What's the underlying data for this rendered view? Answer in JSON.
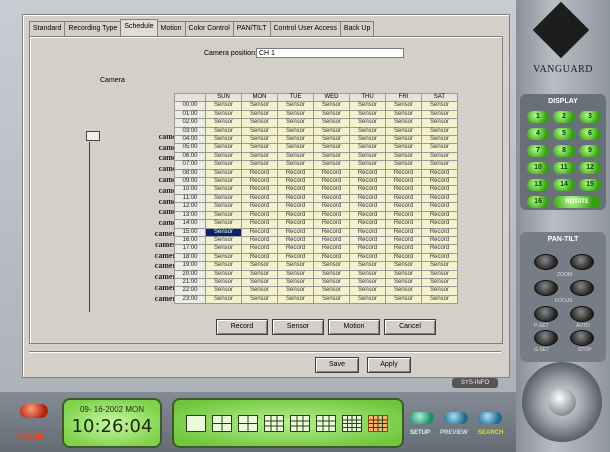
{
  "tabs": [
    "Standard",
    "Recording Type",
    "Schedule",
    "Motion",
    "Color Control",
    "PAN/TILT",
    "Control User Access",
    "Back Up"
  ],
  "active_tab": "Schedule",
  "camera_position_label": "Camera position:",
  "camera_position_value": "CH 1",
  "camera_heading": "Camera",
  "cameras": [
    "camera 1",
    "camera 2",
    "camera 3",
    "camera 4",
    "camera 5",
    "camera 6",
    "camera 7",
    "camera 8",
    "camera 9",
    "camera 10",
    "camera 11",
    "camera 12",
    "camera 13",
    "camera 14",
    "camera 15",
    "camera 16"
  ],
  "selected_camera": "camera 1",
  "days": [
    "SUN",
    "MON",
    "TUE",
    "WED",
    "THU",
    "FRI",
    "SAT"
  ],
  "hours": [
    "00:00",
    "01:00",
    "02:00",
    "03:00",
    "04:00",
    "05:00",
    "06:00",
    "07:00",
    "08:00",
    "09:00",
    "10:00",
    "11:00",
    "12:00",
    "13:00",
    "14:00",
    "15:00",
    "16:00",
    "17:00",
    "18:00",
    "19:00",
    "20:00",
    "21:00",
    "22:00",
    "23:00"
  ],
  "schedule": [
    [
      "Sensor",
      "Sensor",
      "Sensor",
      "Sensor",
      "Sensor",
      "Sensor",
      "Sensor"
    ],
    [
      "Sensor",
      "Sensor",
      "Sensor",
      "Sensor",
      "Sensor",
      "Sensor",
      "Sensor"
    ],
    [
      "Sensor",
      "Sensor",
      "Sensor",
      "Sensor",
      "Sensor",
      "Sensor",
      "Sensor"
    ],
    [
      "Sensor",
      "Sensor",
      "Sensor",
      "Sensor",
      "Sensor",
      "Sensor",
      "Sensor"
    ],
    [
      "Sensor",
      "Sensor",
      "Sensor",
      "Sensor",
      "Sensor",
      "Sensor",
      "Sensor"
    ],
    [
      "Sensor",
      "Sensor",
      "Sensor",
      "Sensor",
      "Sensor",
      "Sensor",
      "Sensor"
    ],
    [
      "Sensor",
      "Sensor",
      "Sensor",
      "Sensor",
      "Sensor",
      "Sensor",
      "Sensor"
    ],
    [
      "Sensor",
      "Sensor",
      "Sensor",
      "Sensor",
      "Sensor",
      "Sensor",
      "Sensor"
    ],
    [
      "Sensor",
      "Record",
      "Record",
      "Record",
      "Record",
      "Record",
      "Record"
    ],
    [
      "Sensor",
      "Record",
      "Record",
      "Record",
      "Record",
      "Record",
      "Record"
    ],
    [
      "Sensor",
      "Record",
      "Record",
      "Record",
      "Record",
      "Record",
      "Record"
    ],
    [
      "Sensor",
      "Record",
      "Record",
      "Record",
      "Record",
      "Record",
      "Record"
    ],
    [
      "Sensor",
      "Record",
      "Record",
      "Record",
      "Record",
      "Record",
      "Record"
    ],
    [
      "Sensor",
      "Record",
      "Record",
      "Record",
      "Record",
      "Record",
      "Record"
    ],
    [
      "Sensor",
      "Record",
      "Record",
      "Record",
      "Record",
      "Record",
      "Record"
    ],
    [
      "Sensor",
      "Record",
      "Record",
      "Record",
      "Record",
      "Record",
      "Record"
    ],
    [
      "Sensor",
      "Record",
      "Record",
      "Record",
      "Record",
      "Record",
      "Record"
    ],
    [
      "Sensor",
      "Record",
      "Record",
      "Record",
      "Record",
      "Record",
      "Record"
    ],
    [
      "Sensor",
      "Record",
      "Record",
      "Record",
      "Record",
      "Record",
      "Record"
    ],
    [
      "Sensor",
      "Sensor",
      "Sensor",
      "Sensor",
      "Sensor",
      "Sensor",
      "Sensor"
    ],
    [
      "Sensor",
      "Sensor",
      "Sensor",
      "Sensor",
      "Sensor",
      "Sensor",
      "Sensor"
    ],
    [
      "Sensor",
      "Sensor",
      "Sensor",
      "Sensor",
      "Sensor",
      "Sensor",
      "Sensor"
    ],
    [
      "Sensor",
      "Sensor",
      "Sensor",
      "Sensor",
      "Sensor",
      "Sensor",
      "Sensor"
    ],
    [
      "Sensor",
      "Sensor",
      "Sensor",
      "Sensor",
      "Sensor",
      "Sensor",
      "Sensor"
    ]
  ],
  "selected_cell": {
    "hour": "15:00",
    "day": "SUN"
  },
  "mode_buttons": [
    "Record",
    "Sensor",
    "Motion",
    "Cancel"
  ],
  "save_label": "Save",
  "apply_label": "Apply",
  "sys_info_label": "SYS-INFO",
  "brand": "VANGUARD",
  "display_label": "DISPLAY",
  "channel_buttons": [
    "1",
    "2",
    "3",
    "4",
    "5",
    "6",
    "7",
    "8",
    "9",
    "10",
    "11",
    "12",
    "13",
    "14",
    "15",
    "16"
  ],
  "rotate_label": "ROTATE",
  "pantilt_label": "PAN-TILT",
  "zoom_label": "ZOOM",
  "focus_label": "FOCUS",
  "pset_label": "P-SET",
  "auto_label": "AUTO",
  "gset_label": "G-SET",
  "stop_label": "STOP",
  "power_label": "POWER",
  "clock_date": "09- 16-2002 MON",
  "clock_time": "10:26:04",
  "layout_selected_index": 7,
  "setup_label": "SETUP",
  "preview_label": "PREVIEW",
  "search_label": "SEARCH",
  "colors": {
    "cell_bg": "#f4f1cf",
    "selected_cell": "#0a246a",
    "search": "#e0e000"
  }
}
